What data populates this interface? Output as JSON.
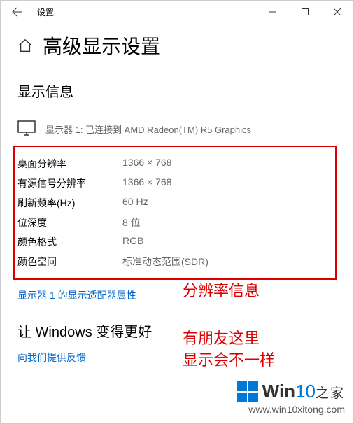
{
  "window": {
    "title": "设置"
  },
  "page": {
    "title": "高级显示设置",
    "section_title": "显示信息",
    "connected_text": "显示器 1: 已连接到 AMD Radeon(TM) R5 Graphics",
    "info": [
      {
        "label": "桌面分辨率",
        "value": "1366 × 768"
      },
      {
        "label": "有源信号分辨率",
        "value": "1366 × 768"
      },
      {
        "label": "刷新频率(Hz)",
        "value": "60 Hz"
      },
      {
        "label": "位深度",
        "value": "8 位"
      },
      {
        "label": "颜色格式",
        "value": "RGB"
      },
      {
        "label": "颜色空间",
        "value": "标准动态范围(SDR)"
      }
    ],
    "adapter_link": "显示器 1 的显示适配器属性",
    "better_title": "让 Windows 变得更好",
    "feedback_link": "向我们提供反馈"
  },
  "annotations": {
    "a1": "分辨率信息",
    "a2_line1": "有朋友这里",
    "a2_line2": "显示会不一样"
  },
  "watermark": {
    "brand_prefix": "Win",
    "brand_num": "10",
    "brand_suffix": "之家",
    "url": "www.win10xitong.com"
  }
}
